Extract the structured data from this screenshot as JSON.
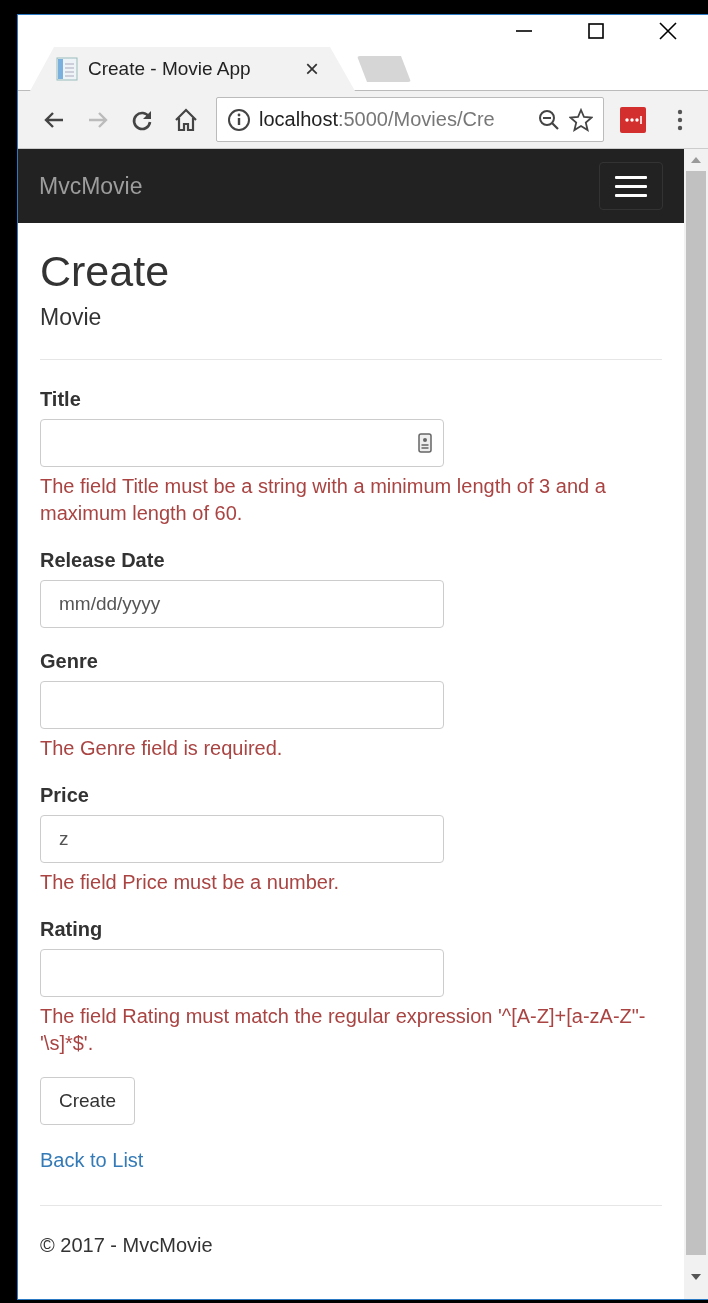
{
  "browser": {
    "tab": {
      "title": "Create - Movie App",
      "close": "×"
    },
    "address": {
      "host": "localhost",
      "path": ":5000/Movies/Cre"
    }
  },
  "navbar": {
    "brand": "MvcMovie"
  },
  "page": {
    "heading": "Create",
    "subheading": "Movie"
  },
  "fields": [
    {
      "label": "Title",
      "autofill": true,
      "error": "The field Title must be a string with a minimum length of 3 and a maximum length of 60."
    },
    {
      "label": "Release Date",
      "autofill": false,
      "placeholder": "mm/dd/yyyy"
    },
    {
      "label": "Genre",
      "autofill": false,
      "error": "The Genre field is required."
    },
    {
      "label": "Price",
      "autofill": false,
      "value": "z",
      "error": "The field Price must be a number."
    },
    {
      "label": "Rating",
      "autofill": false,
      "error": "The field Rating must match the regular expression '^[A-Z]+[a-zA-Z\"-'\\s]*$'."
    }
  ],
  "submit": "Create",
  "back_link": "Back to List",
  "footer": "© 2017 - MvcMovie"
}
